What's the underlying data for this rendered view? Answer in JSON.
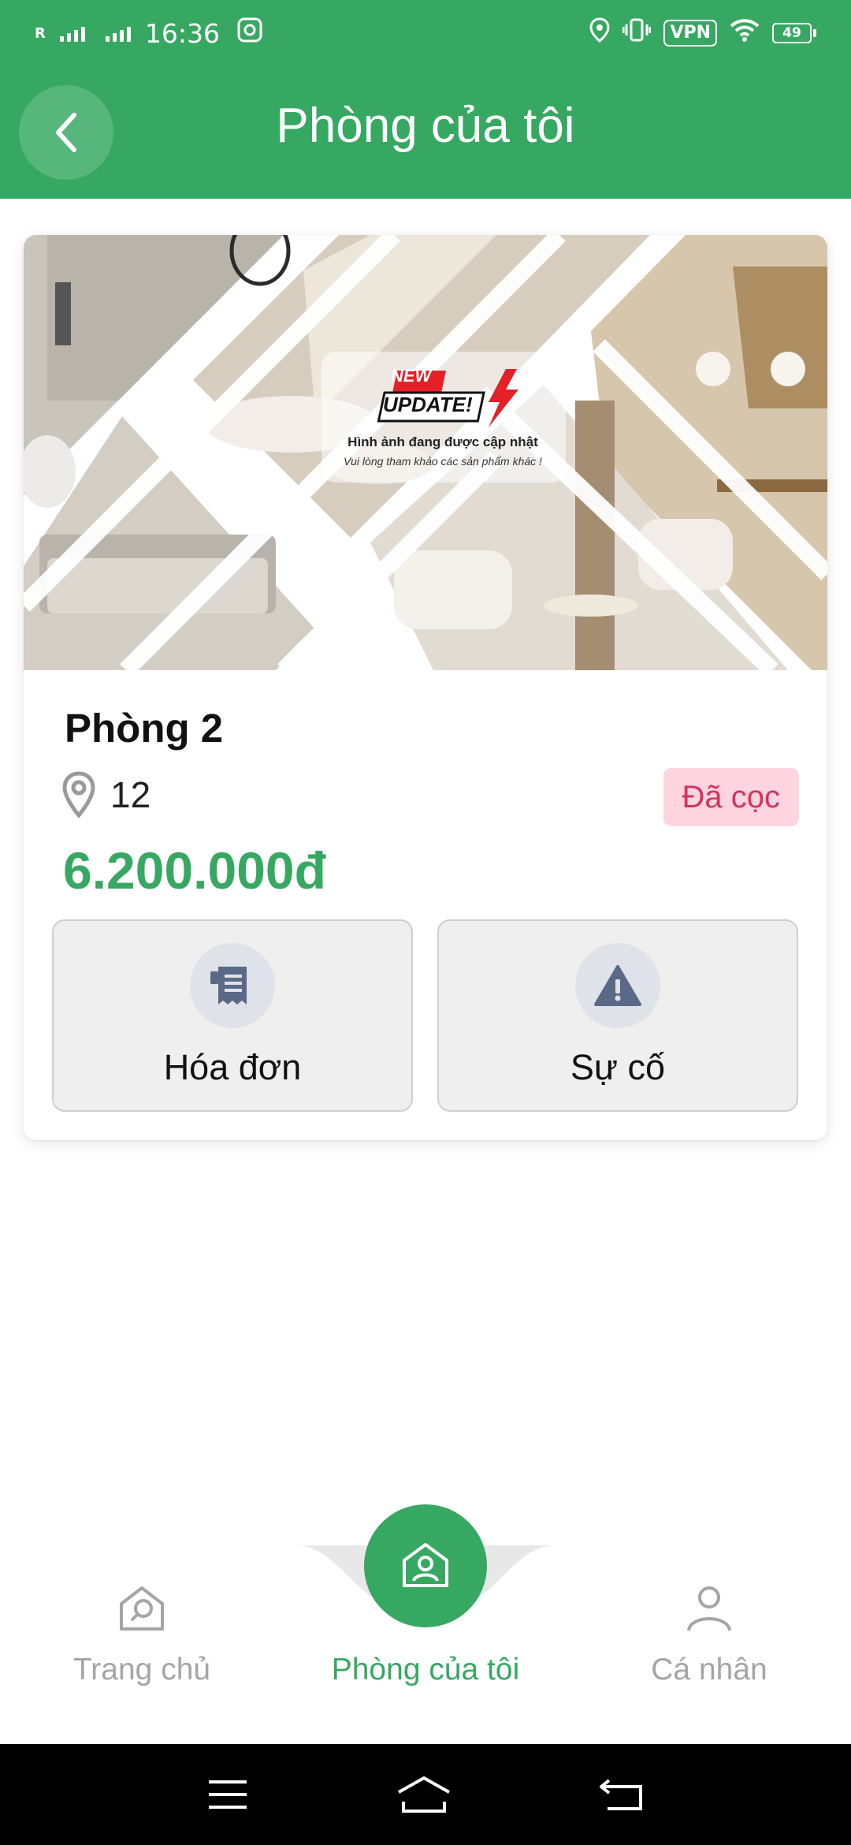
{
  "status_bar": {
    "carrier_mark": "R",
    "time": "16:36",
    "vpn": "VPN",
    "battery": "49"
  },
  "header": {
    "title": "Phòng của tôi",
    "back_icon": "chevron-left-icon"
  },
  "room": {
    "image": {
      "badge_top": "NEW",
      "badge_main": "UPDATE!",
      "headline": "Hình ảnh đang được cập nhật",
      "subline": "Vui lòng tham khảo các sản phẩm khác !"
    },
    "name": "Phòng 2",
    "location": "12",
    "status": "Đã cọc",
    "price": "6.200.000đ",
    "actions": [
      {
        "label": "Hóa đơn",
        "icon": "receipt-icon"
      },
      {
        "label": "Sự cố",
        "icon": "warning-icon"
      }
    ]
  },
  "tabs": [
    {
      "label": "Trang chủ",
      "icon": "home-search-icon",
      "active": false
    },
    {
      "label": "Phòng của tôi",
      "icon": "room-user-icon",
      "active": true
    },
    {
      "label": "Cá nhân",
      "icon": "person-icon",
      "active": false
    }
  ],
  "colors": {
    "primary": "#36a862",
    "badge_bg": "#fdd4df",
    "badge_text": "#d2335f",
    "action_icon": "#5a6a86"
  }
}
